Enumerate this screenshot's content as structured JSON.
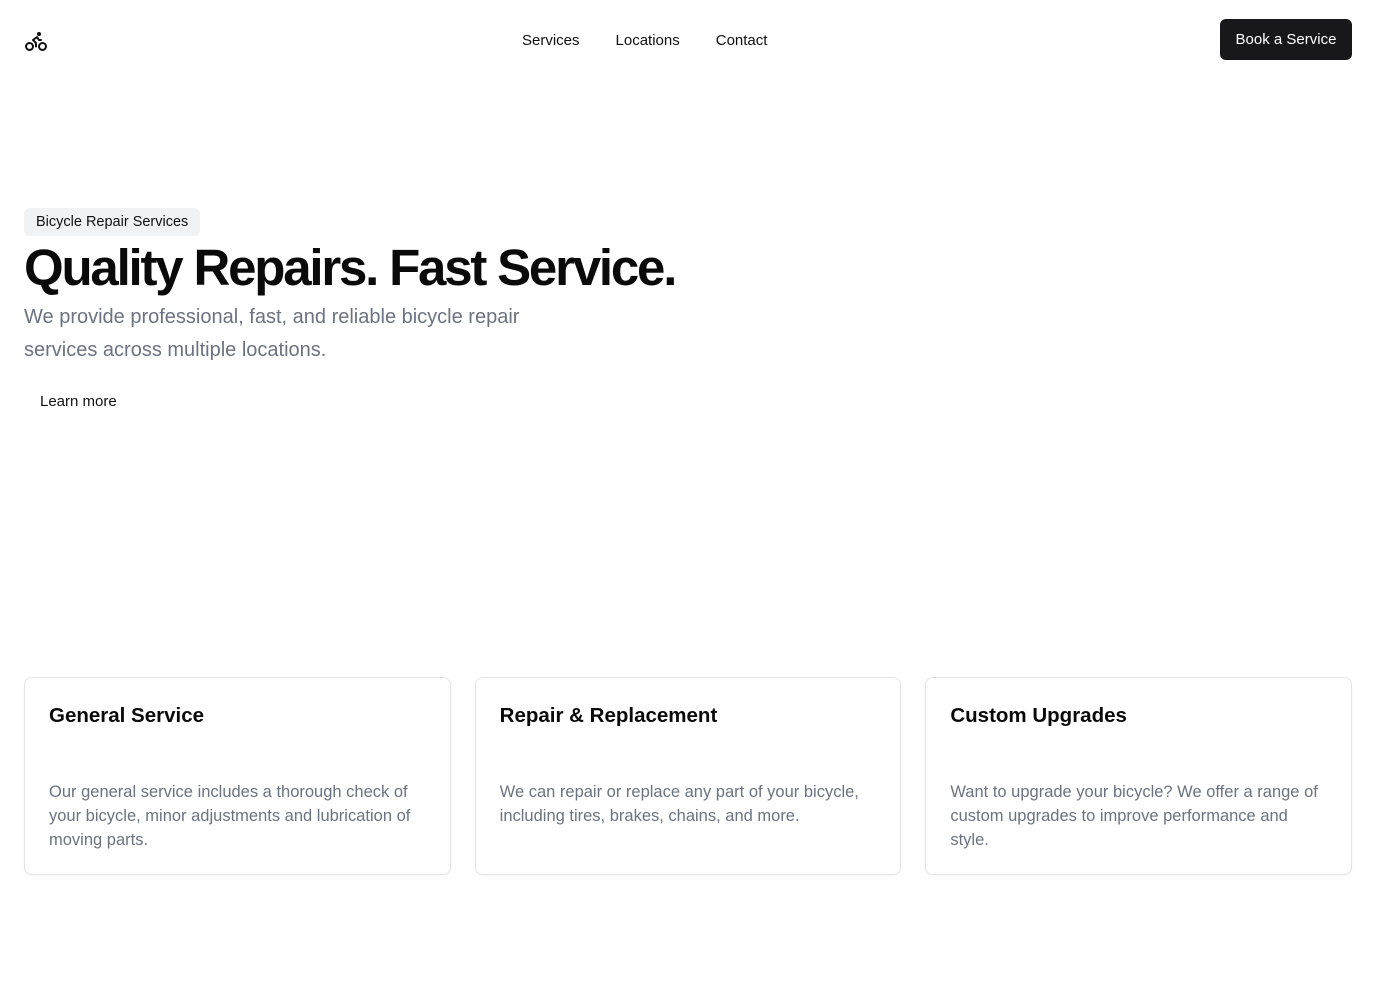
{
  "header": {
    "logo_icon": "bicycle-icon",
    "nav": [
      {
        "label": "Services"
      },
      {
        "label": "Locations"
      },
      {
        "label": "Contact"
      }
    ],
    "cta_label": "Book a Service"
  },
  "hero": {
    "badge": "Bicycle Repair Services",
    "title": "Quality Repairs. Fast Service.",
    "description": "We provide professional, fast, and reliable bicycle repair services across multiple locations.",
    "learn_more_label": "Learn more"
  },
  "cards": [
    {
      "title": "General Service",
      "description": "Our general service includes a thorough check of your bicycle, minor adjustments and lubrication of moving parts."
    },
    {
      "title": "Repair & Replacement",
      "description": "We can repair or replace any part of your bicycle, including tires, brakes, chains, and more."
    },
    {
      "title": "Custom Upgrades",
      "description": "Want to upgrade your bicycle? We offer a range of custom upgrades to improve performance and style."
    }
  ],
  "colors": {
    "primary_button": "#18181b",
    "muted_text": "#6b7280",
    "badge_bg": "#f1f2f4",
    "card_border": "#e4e4e7"
  }
}
